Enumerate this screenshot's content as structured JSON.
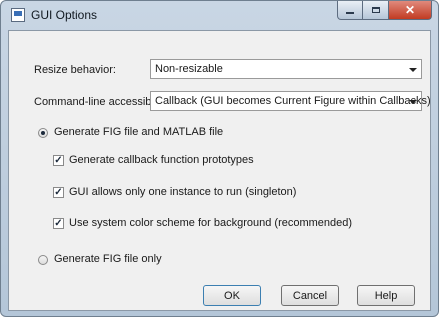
{
  "window": {
    "title": "GUI Options"
  },
  "resize": {
    "label": "Resize behavior:",
    "value": "Non-resizable"
  },
  "cmdline": {
    "label": "Command-line accessibility:",
    "value": "Callback (GUI becomes Current Figure within Callbacks)"
  },
  "options": {
    "fig_and_matlab": "Generate FIG file and MATLAB file",
    "fig_only": "Generate FIG file only",
    "selected": "fig_and_matlab"
  },
  "checkboxes": [
    {
      "label": "Generate callback function prototypes",
      "checked": true
    },
    {
      "label": "GUI allows only one instance to run (singleton)",
      "checked": true
    },
    {
      "label": "Use system color scheme for background (recommended)",
      "checked": true
    }
  ],
  "buttons": {
    "ok": "OK",
    "cancel": "Cancel",
    "help": "Help"
  }
}
